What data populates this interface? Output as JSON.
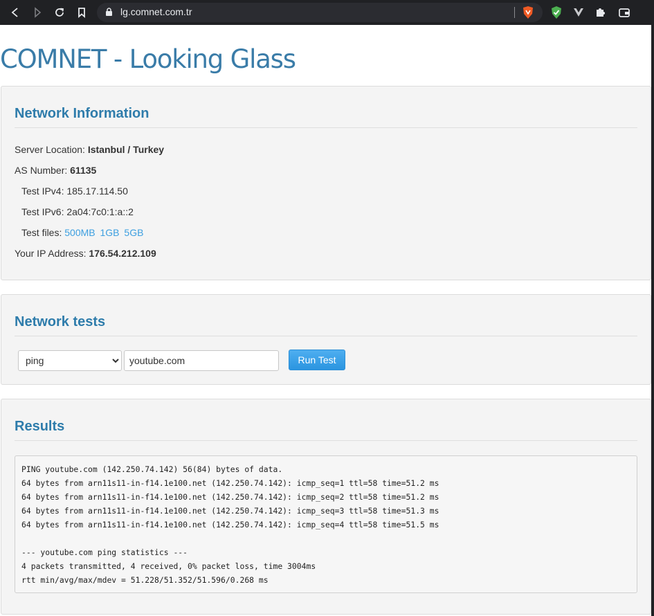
{
  "browser": {
    "url": "lg.comnet.com.tr",
    "colors": {
      "chrome": "#202124",
      "urlbar": "#2b2c31"
    },
    "icons": [
      "back-icon",
      "forward-icon",
      "reload-icon",
      "bookmark-icon",
      "lock-icon",
      "brave-shield-icon",
      "adguard-icon",
      "vivaldi-icon",
      "extensions-icon",
      "wallet-icon"
    ]
  },
  "page": {
    "title": "COMNET - Looking Glass",
    "accent_color": "#2e7cab",
    "link_color": "#3d9fe0"
  },
  "network_info": {
    "heading": "Network Information",
    "server_location_label": "Server Location:",
    "server_location_value": "Istanbul / Turkey",
    "as_number_label": "AS Number:",
    "as_number_value": "61135",
    "ipv4_label": "Test IPv4:",
    "ipv4_value": "185.17.114.50",
    "ipv6_label": "Test IPv6:",
    "ipv6_value": "2a04:7c0:1:a::2",
    "files_label": "Test files:",
    "files": [
      "500MB",
      "1GB",
      "5GB"
    ],
    "your_ip_label": "Your IP Address:",
    "your_ip_value": "176.54.212.109"
  },
  "network_tests": {
    "heading": "Network tests",
    "method_selected": "ping",
    "target_value": "youtube.com",
    "run_label": "Run Test",
    "button_color": "#2b95e0"
  },
  "results": {
    "heading": "Results",
    "output": "PING youtube.com (142.250.74.142) 56(84) bytes of data.\n64 bytes from arn11s11-in-f14.1e100.net (142.250.74.142): icmp_seq=1 ttl=58 time=51.2 ms\n64 bytes from arn11s11-in-f14.1e100.net (142.250.74.142): icmp_seq=2 ttl=58 time=51.2 ms\n64 bytes from arn11s11-in-f14.1e100.net (142.250.74.142): icmp_seq=3 ttl=58 time=51.3 ms\n64 bytes from arn11s11-in-f14.1e100.net (142.250.74.142): icmp_seq=4 ttl=58 time=51.5 ms\n\n--- youtube.com ping statistics ---\n4 packets transmitted, 4 received, 0% packet loss, time 3004ms\nrtt min/avg/max/mdev = 51.228/51.352/51.596/0.268 ms"
  }
}
